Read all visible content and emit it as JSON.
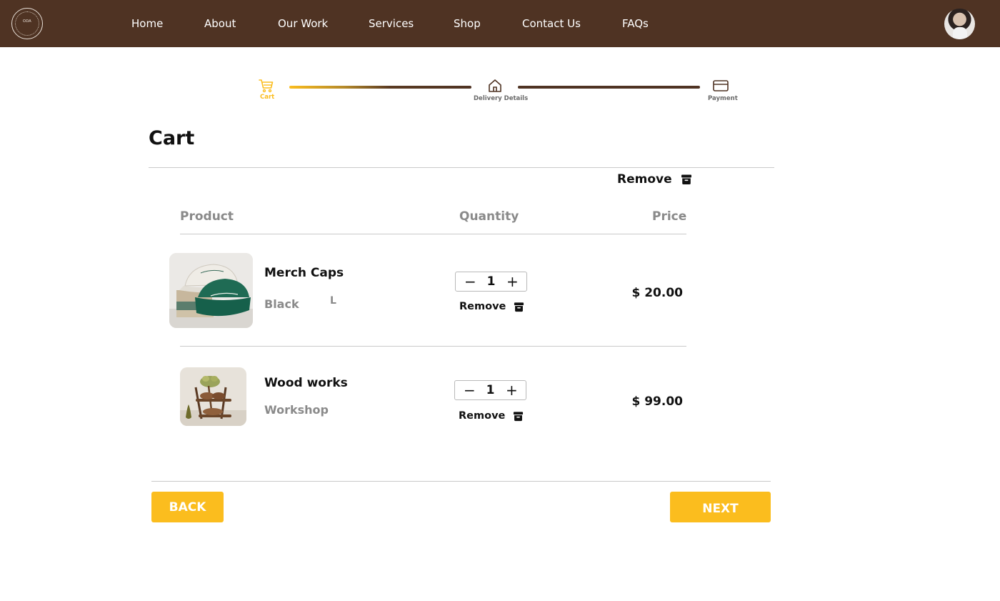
{
  "brand": {
    "logo_text": "ODA"
  },
  "nav": {
    "items": [
      {
        "label": "Home"
      },
      {
        "label": "About"
      },
      {
        "label": "Our Work"
      },
      {
        "label": "Services"
      },
      {
        "label": "Shop"
      },
      {
        "label": "Contact Us"
      },
      {
        "label": "FAQs"
      }
    ]
  },
  "stepper": {
    "steps": [
      {
        "label": "Cart",
        "icon": "cart-icon",
        "active": true
      },
      {
        "label": "Delivery Details",
        "icon": "home-icon",
        "active": false
      },
      {
        "label": "Payment",
        "icon": "credit-card-icon",
        "active": false
      }
    ]
  },
  "cart": {
    "title": "Cart",
    "remove_all_label": "Remove",
    "columns": {
      "product": "Product",
      "quantity": "Quantity",
      "price": "Price"
    },
    "items": [
      {
        "name": "Merch Caps",
        "variant": "Black",
        "size": "L",
        "quantity": "1",
        "remove_label": "Remove",
        "price": "$ 20.00"
      },
      {
        "name": "Wood works",
        "variant": "Workshop",
        "quantity": "1",
        "remove_label": "Remove",
        "price": "$ 99.00"
      }
    ]
  },
  "actions": {
    "back_label": "BACK",
    "next_label": "NEXT"
  },
  "colors": {
    "header_bg": "#4f3323",
    "accent": "#fbbd1e",
    "muted_text": "#8a8a8a"
  }
}
